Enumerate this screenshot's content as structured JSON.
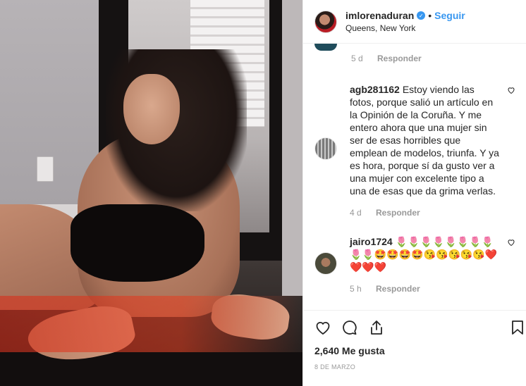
{
  "post": {
    "username": "imlorenaduran",
    "follow_label": "Seguir",
    "separator": "•",
    "location": "Queens, New York"
  },
  "comments": [
    {
      "user": "",
      "text": "",
      "time": "5 d",
      "reply_label": "Responder"
    },
    {
      "user": "agb281162",
      "text": "Estoy viendo las fotos, porque salió un artículo en la Opinión de la Coruña. Y me entero ahora que una mujer sin ser de esas horribles que emplean de modelos, triunfa. Y ya es hora, porque sí da gusto ver a una mujer con excelente tipo a una de esas que da grima verlas.",
      "time": "4 d",
      "reply_label": "Responder"
    },
    {
      "user": "jairo1724",
      "text": "🌷🌷🌷🌷🌷🌷🌷🌷🌷🌷🤩🤩🤩🤩😘😘😘😘😘❤️❤️❤️❤️",
      "time": "5 h",
      "reply_label": "Responder"
    }
  ],
  "likes": "2,640 Me gusta",
  "date": "8 DE MARZO",
  "icons": {
    "like": "heart-icon",
    "comment": "comment-icon",
    "share": "share-icon",
    "save": "bookmark-icon",
    "verified": "verified-badge-icon"
  },
  "colors": {
    "accent": "#3897f0",
    "text": "#262626",
    "muted": "#999999"
  }
}
